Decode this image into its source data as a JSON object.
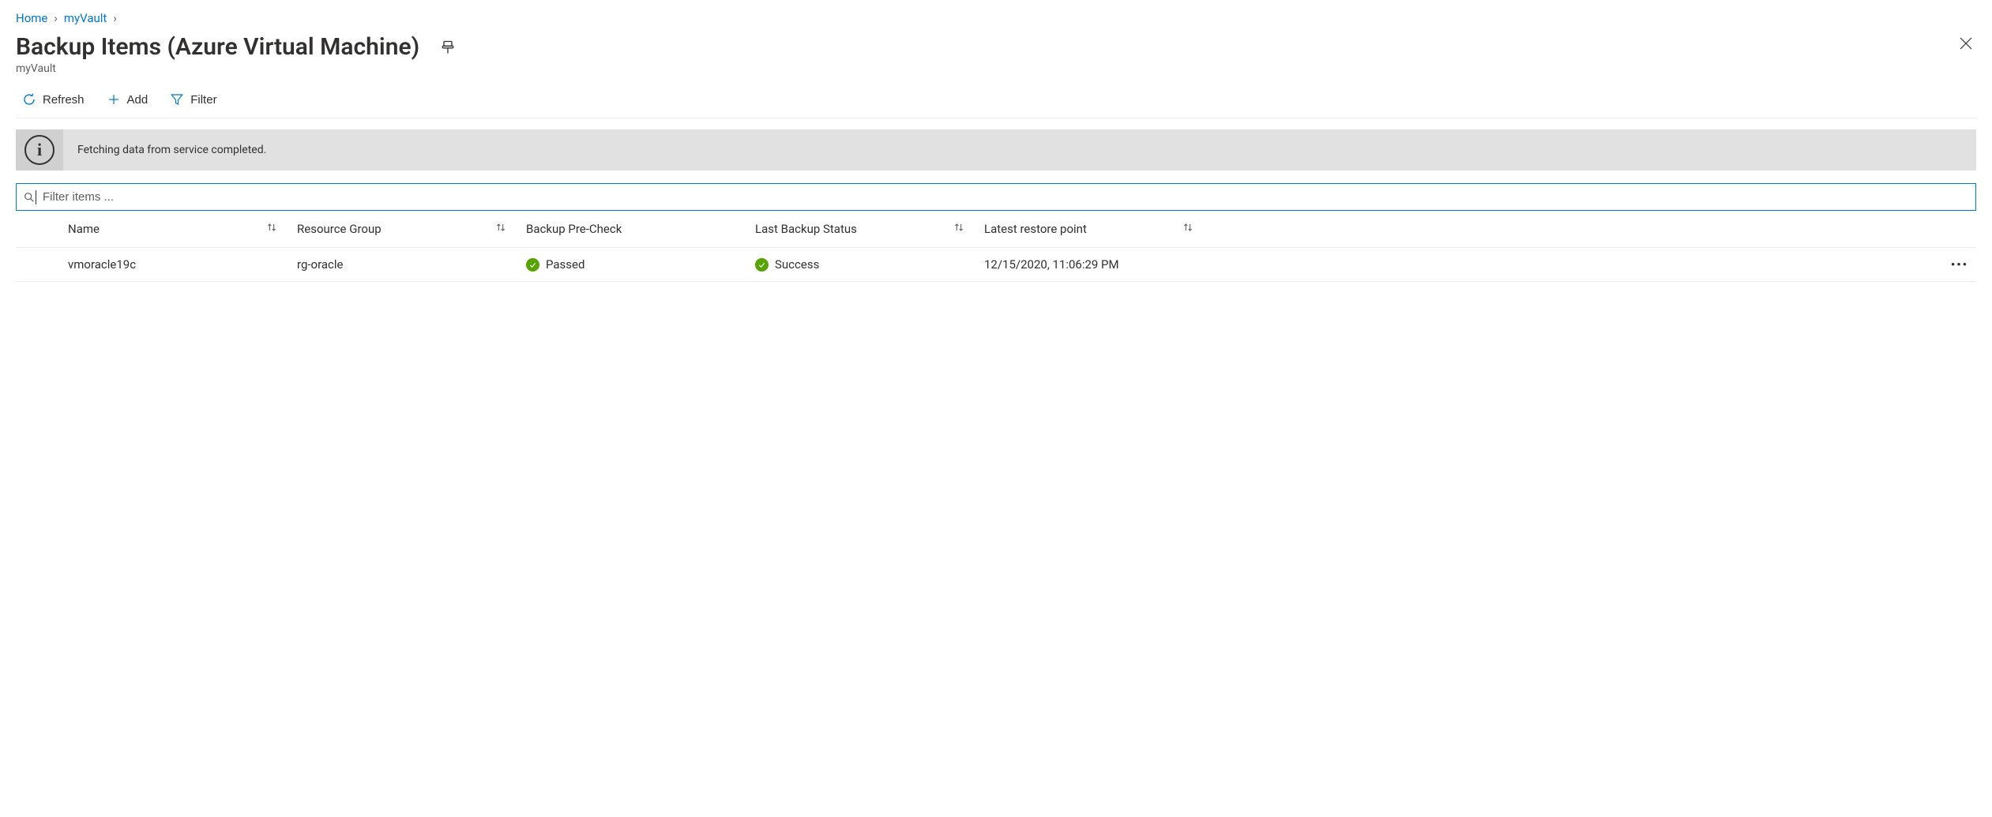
{
  "breadcrumb": {
    "home": "Home",
    "vault": "myVault"
  },
  "header": {
    "title": "Backup Items (Azure Virtual Machine)",
    "subtitle": "myVault"
  },
  "toolbar": {
    "refresh": "Refresh",
    "add": "Add",
    "filter": "Filter"
  },
  "notification": {
    "text": "Fetching data from service completed."
  },
  "filter": {
    "placeholder": "Filter items ..."
  },
  "table": {
    "headers": {
      "name": "Name",
      "resource_group": "Resource Group",
      "pre_check": "Backup Pre-Check",
      "last_status": "Last Backup Status",
      "restore_point": "Latest restore point"
    },
    "rows": [
      {
        "name": "vmoracle19c",
        "resource_group": "rg-oracle",
        "pre_check": "Passed",
        "last_status": "Success",
        "restore_point": "12/15/2020, 11:06:29 PM"
      }
    ]
  }
}
